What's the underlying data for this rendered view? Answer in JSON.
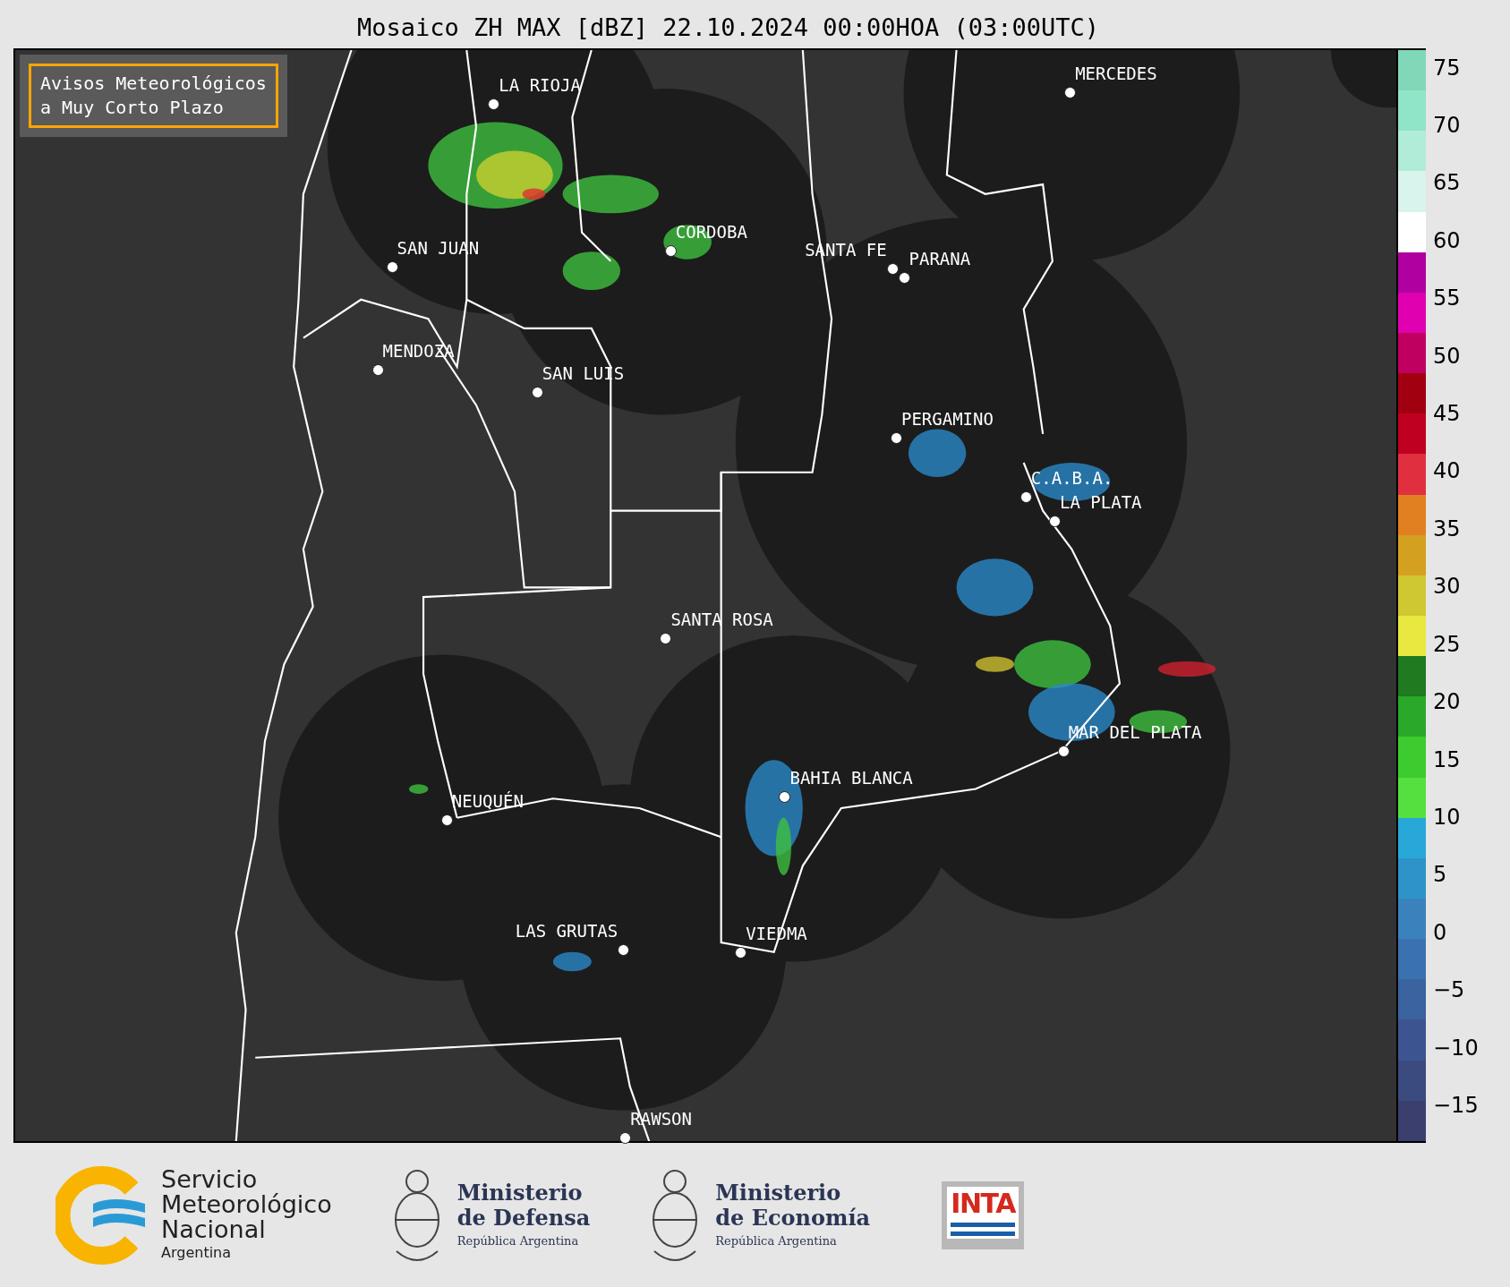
{
  "title": "Mosaico ZH MAX [dBZ] 22.10.2024 00:00HOA (03:00UTC)",
  "alert_box": {
    "lines": [
      "Avisos Meteorológicos",
      "a Muy Corto Plazo"
    ]
  },
  "cities": [
    {
      "name": "LA RIOJA"
    },
    {
      "name": "SAN JUAN"
    },
    {
      "name": "CORDOBA"
    },
    {
      "name": "SANTA FE"
    },
    {
      "name": "PARANA"
    },
    {
      "name": "MERCEDES"
    },
    {
      "name": "MENDOZA"
    },
    {
      "name": "SAN LUIS"
    },
    {
      "name": "PERGAMINO"
    },
    {
      "name": "C.A.B.A."
    },
    {
      "name": "LA PLATA"
    },
    {
      "name": "SANTA ROSA"
    },
    {
      "name": "MAR DEL PLATA"
    },
    {
      "name": "BAHIA BLANCA"
    },
    {
      "name": "NEUQUÉN"
    },
    {
      "name": "LAS GRUTAS"
    },
    {
      "name": "VIEDMA"
    },
    {
      "name": "RAWSON"
    }
  ],
  "colorbar": {
    "ticks": [
      "75",
      "70",
      "65",
      "60",
      "55",
      "50",
      "45",
      "40",
      "35",
      "30",
      "25",
      "20",
      "15",
      "10",
      "5",
      "0",
      "−5",
      "−10",
      "−15"
    ]
  },
  "footer": {
    "smn": {
      "lines": [
        "Servicio",
        "Meteorológico",
        "Nacional"
      ],
      "country": "Argentina"
    },
    "ministries": [
      {
        "lines": [
          "Ministerio",
          "de Defensa"
        ],
        "country": "República Argentina"
      },
      {
        "lines": [
          "Ministerio",
          "de Economía"
        ],
        "country": "República Argentina"
      }
    ],
    "inta": {
      "text": "INTA"
    }
  }
}
